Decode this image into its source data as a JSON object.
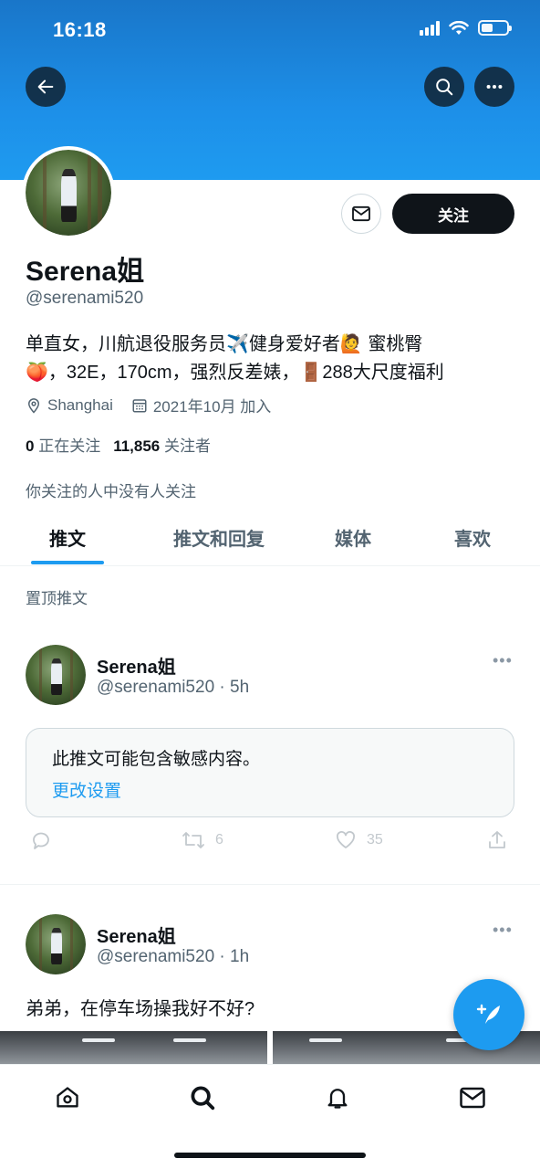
{
  "status_bar": {
    "time": "16:18",
    "battery_level": 0.45
  },
  "colors": {
    "banner": "#1d8fe8",
    "accent": "#1d9bf0",
    "text": "#0f1419",
    "muted": "#536471"
  },
  "header": {
    "back_icon": "arrow-left-icon",
    "search_icon": "search-icon",
    "more_icon": "more-horizontal-icon"
  },
  "profile": {
    "display_name": "Serena姐",
    "handle": "@serenami520",
    "bio_line1": "单直女，川航退役服务员✈️健身爱好者🙋 蜜桃臀",
    "bio_line2": "🍑，32E，170cm，强烈反差婊，🚪288大尺度福利",
    "location": "Shanghai",
    "joined": "2021年10月 加入",
    "following_count": "0",
    "following_label": "正在关注",
    "followers_count": "11,856",
    "followers_label": "关注者",
    "followed_by_note": "你关注的人中没有人关注"
  },
  "actions": {
    "follow_label": "关注",
    "message_icon": "mail-icon"
  },
  "tabs": [
    {
      "label": "推文",
      "active": true
    },
    {
      "label": "推文和回复",
      "active": false
    },
    {
      "label": "媒体",
      "active": false
    },
    {
      "label": "喜欢",
      "active": false
    }
  ],
  "pinned_label": "置顶推文",
  "tweets": [
    {
      "name": "Serena姐",
      "handle_time": "@serenami520 · 5h",
      "sensitive_notice": "此推文可能包含敏感内容。",
      "sensitive_link": "更改设置",
      "retweets": "6",
      "likes": "35"
    },
    {
      "name": "Serena姐",
      "handle_time": "@serenami520 · 1h",
      "text": "弟弟，在停车场操我好不好?"
    }
  ],
  "bottom_nav": [
    "home-icon",
    "search-icon",
    "notifications-bell-icon",
    "messages-mail-icon"
  ]
}
